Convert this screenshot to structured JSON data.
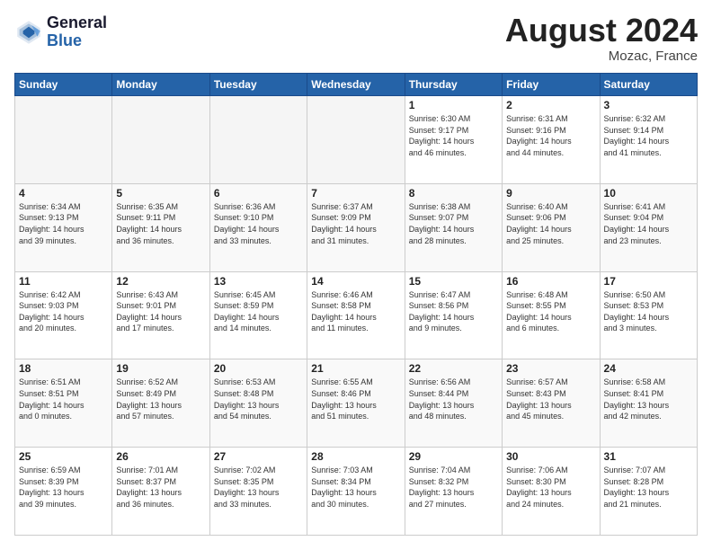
{
  "header": {
    "logo_line1": "General",
    "logo_line2": "Blue",
    "month_title": "August 2024",
    "location": "Mozac, France"
  },
  "days_of_week": [
    "Sunday",
    "Monday",
    "Tuesday",
    "Wednesday",
    "Thursday",
    "Friday",
    "Saturday"
  ],
  "weeks": [
    [
      {
        "day": "",
        "info": ""
      },
      {
        "day": "",
        "info": ""
      },
      {
        "day": "",
        "info": ""
      },
      {
        "day": "",
        "info": ""
      },
      {
        "day": "1",
        "info": "Sunrise: 6:30 AM\nSunset: 9:17 PM\nDaylight: 14 hours\nand 46 minutes."
      },
      {
        "day": "2",
        "info": "Sunrise: 6:31 AM\nSunset: 9:16 PM\nDaylight: 14 hours\nand 44 minutes."
      },
      {
        "day": "3",
        "info": "Sunrise: 6:32 AM\nSunset: 9:14 PM\nDaylight: 14 hours\nand 41 minutes."
      }
    ],
    [
      {
        "day": "4",
        "info": "Sunrise: 6:34 AM\nSunset: 9:13 PM\nDaylight: 14 hours\nand 39 minutes."
      },
      {
        "day": "5",
        "info": "Sunrise: 6:35 AM\nSunset: 9:11 PM\nDaylight: 14 hours\nand 36 minutes."
      },
      {
        "day": "6",
        "info": "Sunrise: 6:36 AM\nSunset: 9:10 PM\nDaylight: 14 hours\nand 33 minutes."
      },
      {
        "day": "7",
        "info": "Sunrise: 6:37 AM\nSunset: 9:09 PM\nDaylight: 14 hours\nand 31 minutes."
      },
      {
        "day": "8",
        "info": "Sunrise: 6:38 AM\nSunset: 9:07 PM\nDaylight: 14 hours\nand 28 minutes."
      },
      {
        "day": "9",
        "info": "Sunrise: 6:40 AM\nSunset: 9:06 PM\nDaylight: 14 hours\nand 25 minutes."
      },
      {
        "day": "10",
        "info": "Sunrise: 6:41 AM\nSunset: 9:04 PM\nDaylight: 14 hours\nand 23 minutes."
      }
    ],
    [
      {
        "day": "11",
        "info": "Sunrise: 6:42 AM\nSunset: 9:03 PM\nDaylight: 14 hours\nand 20 minutes."
      },
      {
        "day": "12",
        "info": "Sunrise: 6:43 AM\nSunset: 9:01 PM\nDaylight: 14 hours\nand 17 minutes."
      },
      {
        "day": "13",
        "info": "Sunrise: 6:45 AM\nSunset: 8:59 PM\nDaylight: 14 hours\nand 14 minutes."
      },
      {
        "day": "14",
        "info": "Sunrise: 6:46 AM\nSunset: 8:58 PM\nDaylight: 14 hours\nand 11 minutes."
      },
      {
        "day": "15",
        "info": "Sunrise: 6:47 AM\nSunset: 8:56 PM\nDaylight: 14 hours\nand 9 minutes."
      },
      {
        "day": "16",
        "info": "Sunrise: 6:48 AM\nSunset: 8:55 PM\nDaylight: 14 hours\nand 6 minutes."
      },
      {
        "day": "17",
        "info": "Sunrise: 6:50 AM\nSunset: 8:53 PM\nDaylight: 14 hours\nand 3 minutes."
      }
    ],
    [
      {
        "day": "18",
        "info": "Sunrise: 6:51 AM\nSunset: 8:51 PM\nDaylight: 14 hours\nand 0 minutes."
      },
      {
        "day": "19",
        "info": "Sunrise: 6:52 AM\nSunset: 8:49 PM\nDaylight: 13 hours\nand 57 minutes."
      },
      {
        "day": "20",
        "info": "Sunrise: 6:53 AM\nSunset: 8:48 PM\nDaylight: 13 hours\nand 54 minutes."
      },
      {
        "day": "21",
        "info": "Sunrise: 6:55 AM\nSunset: 8:46 PM\nDaylight: 13 hours\nand 51 minutes."
      },
      {
        "day": "22",
        "info": "Sunrise: 6:56 AM\nSunset: 8:44 PM\nDaylight: 13 hours\nand 48 minutes."
      },
      {
        "day": "23",
        "info": "Sunrise: 6:57 AM\nSunset: 8:43 PM\nDaylight: 13 hours\nand 45 minutes."
      },
      {
        "day": "24",
        "info": "Sunrise: 6:58 AM\nSunset: 8:41 PM\nDaylight: 13 hours\nand 42 minutes."
      }
    ],
    [
      {
        "day": "25",
        "info": "Sunrise: 6:59 AM\nSunset: 8:39 PM\nDaylight: 13 hours\nand 39 minutes."
      },
      {
        "day": "26",
        "info": "Sunrise: 7:01 AM\nSunset: 8:37 PM\nDaylight: 13 hours\nand 36 minutes."
      },
      {
        "day": "27",
        "info": "Sunrise: 7:02 AM\nSunset: 8:35 PM\nDaylight: 13 hours\nand 33 minutes."
      },
      {
        "day": "28",
        "info": "Sunrise: 7:03 AM\nSunset: 8:34 PM\nDaylight: 13 hours\nand 30 minutes."
      },
      {
        "day": "29",
        "info": "Sunrise: 7:04 AM\nSunset: 8:32 PM\nDaylight: 13 hours\nand 27 minutes."
      },
      {
        "day": "30",
        "info": "Sunrise: 7:06 AM\nSunset: 8:30 PM\nDaylight: 13 hours\nand 24 minutes."
      },
      {
        "day": "31",
        "info": "Sunrise: 7:07 AM\nSunset: 8:28 PM\nDaylight: 13 hours\nand 21 minutes."
      }
    ]
  ]
}
